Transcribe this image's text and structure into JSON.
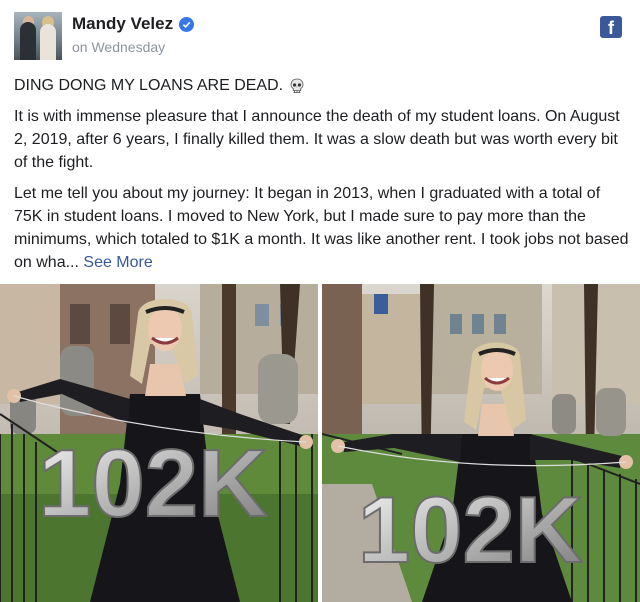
{
  "post": {
    "author_name": "Mandy Velez",
    "timestamp": "on Wednesday",
    "verified_icon": "verified-badge-icon",
    "network_icon": "facebook-icon",
    "headline": "DING DONG MY LOANS ARE DEAD.",
    "headline_emoji": "skull-icon",
    "paragraph_1": "It is with immense pleasure that I announce the death of my student loans. On August 2, 2019, after 6 years, I finally killed them. It was a slow death but was worth every bit of the fight.",
    "paragraph_2": "Let me tell you about my journey: It began in 2013, when I graduated with a total of 75K in student loans. I moved to New York, but I made sure to pay more than the minimums, which totaled to $1K a month. It was like another rent. I took jobs not based on wha...",
    "see_more": "See More"
  },
  "photos": {
    "balloon_text": "102K",
    "colors": {
      "balloon": "#c9c9c9",
      "dress": "#16161a",
      "grass": "#5f8a3a",
      "link": "#385898",
      "facebook": "#3b5998"
    }
  }
}
